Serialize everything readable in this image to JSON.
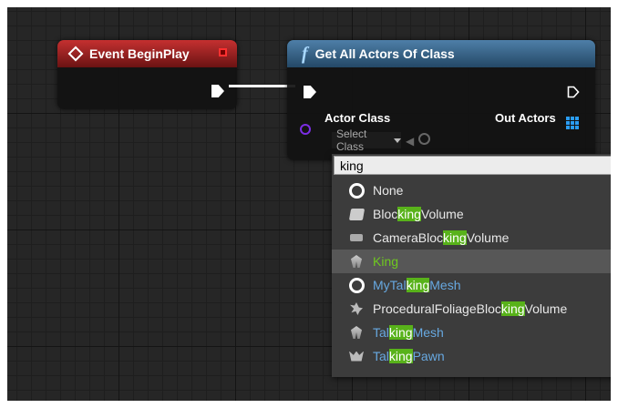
{
  "nodes": {
    "begin_play": {
      "title": "Event BeginPlay"
    },
    "get_actors": {
      "title": "Get All Actors Of Class",
      "icon_glyph": "f",
      "input_label": "Actor Class",
      "output_label": "Out Actors",
      "class_select_value": "Select Class"
    }
  },
  "search": {
    "query": "king"
  },
  "results": [
    {
      "name": "None",
      "icon": "ring-icon",
      "style": "normal",
      "parts": [
        {
          "t": "None",
          "m": false
        }
      ]
    },
    {
      "name": "BlockingVolume",
      "icon": "blocking-volume-icon",
      "style": "normal",
      "parts": [
        {
          "t": "Bloc",
          "m": false
        },
        {
          "t": "king",
          "m": true
        },
        {
          "t": "Volume",
          "m": false
        }
      ]
    },
    {
      "name": "CameraBlockingVolume",
      "icon": "camera-volume-icon",
      "style": "normal",
      "parts": [
        {
          "t": "CameraBloc",
          "m": false
        },
        {
          "t": "king",
          "m": true
        },
        {
          "t": "Volume",
          "m": false
        }
      ]
    },
    {
      "name": "King",
      "icon": "actor-icon",
      "style": "green",
      "highlighted": true,
      "parts": [
        {
          "t": "King",
          "m": false
        }
      ]
    },
    {
      "name": "MyTalkingMesh",
      "icon": "ring-icon",
      "style": "blue",
      "parts": [
        {
          "t": "MyTal",
          "m": false
        },
        {
          "t": "king",
          "m": true
        },
        {
          "t": "Mesh",
          "m": false
        }
      ]
    },
    {
      "name": "ProceduralFoliageBlockingVolume",
      "icon": "foliage-icon",
      "style": "normal",
      "parts": [
        {
          "t": "ProceduralFoliageBloc",
          "m": false
        },
        {
          "t": "king",
          "m": true
        },
        {
          "t": "Volume",
          "m": false
        }
      ]
    },
    {
      "name": "TalkingMesh",
      "icon": "actor-icon",
      "style": "blue",
      "parts": [
        {
          "t": "Tal",
          "m": false
        },
        {
          "t": "king",
          "m": true
        },
        {
          "t": "Mesh",
          "m": false
        }
      ]
    },
    {
      "name": "TalkingPawn",
      "icon": "pawn-icon",
      "style": "blue",
      "parts": [
        {
          "t": "Tal",
          "m": false
        },
        {
          "t": "king",
          "m": true
        },
        {
          "t": "Pawn",
          "m": false
        }
      ]
    }
  ]
}
